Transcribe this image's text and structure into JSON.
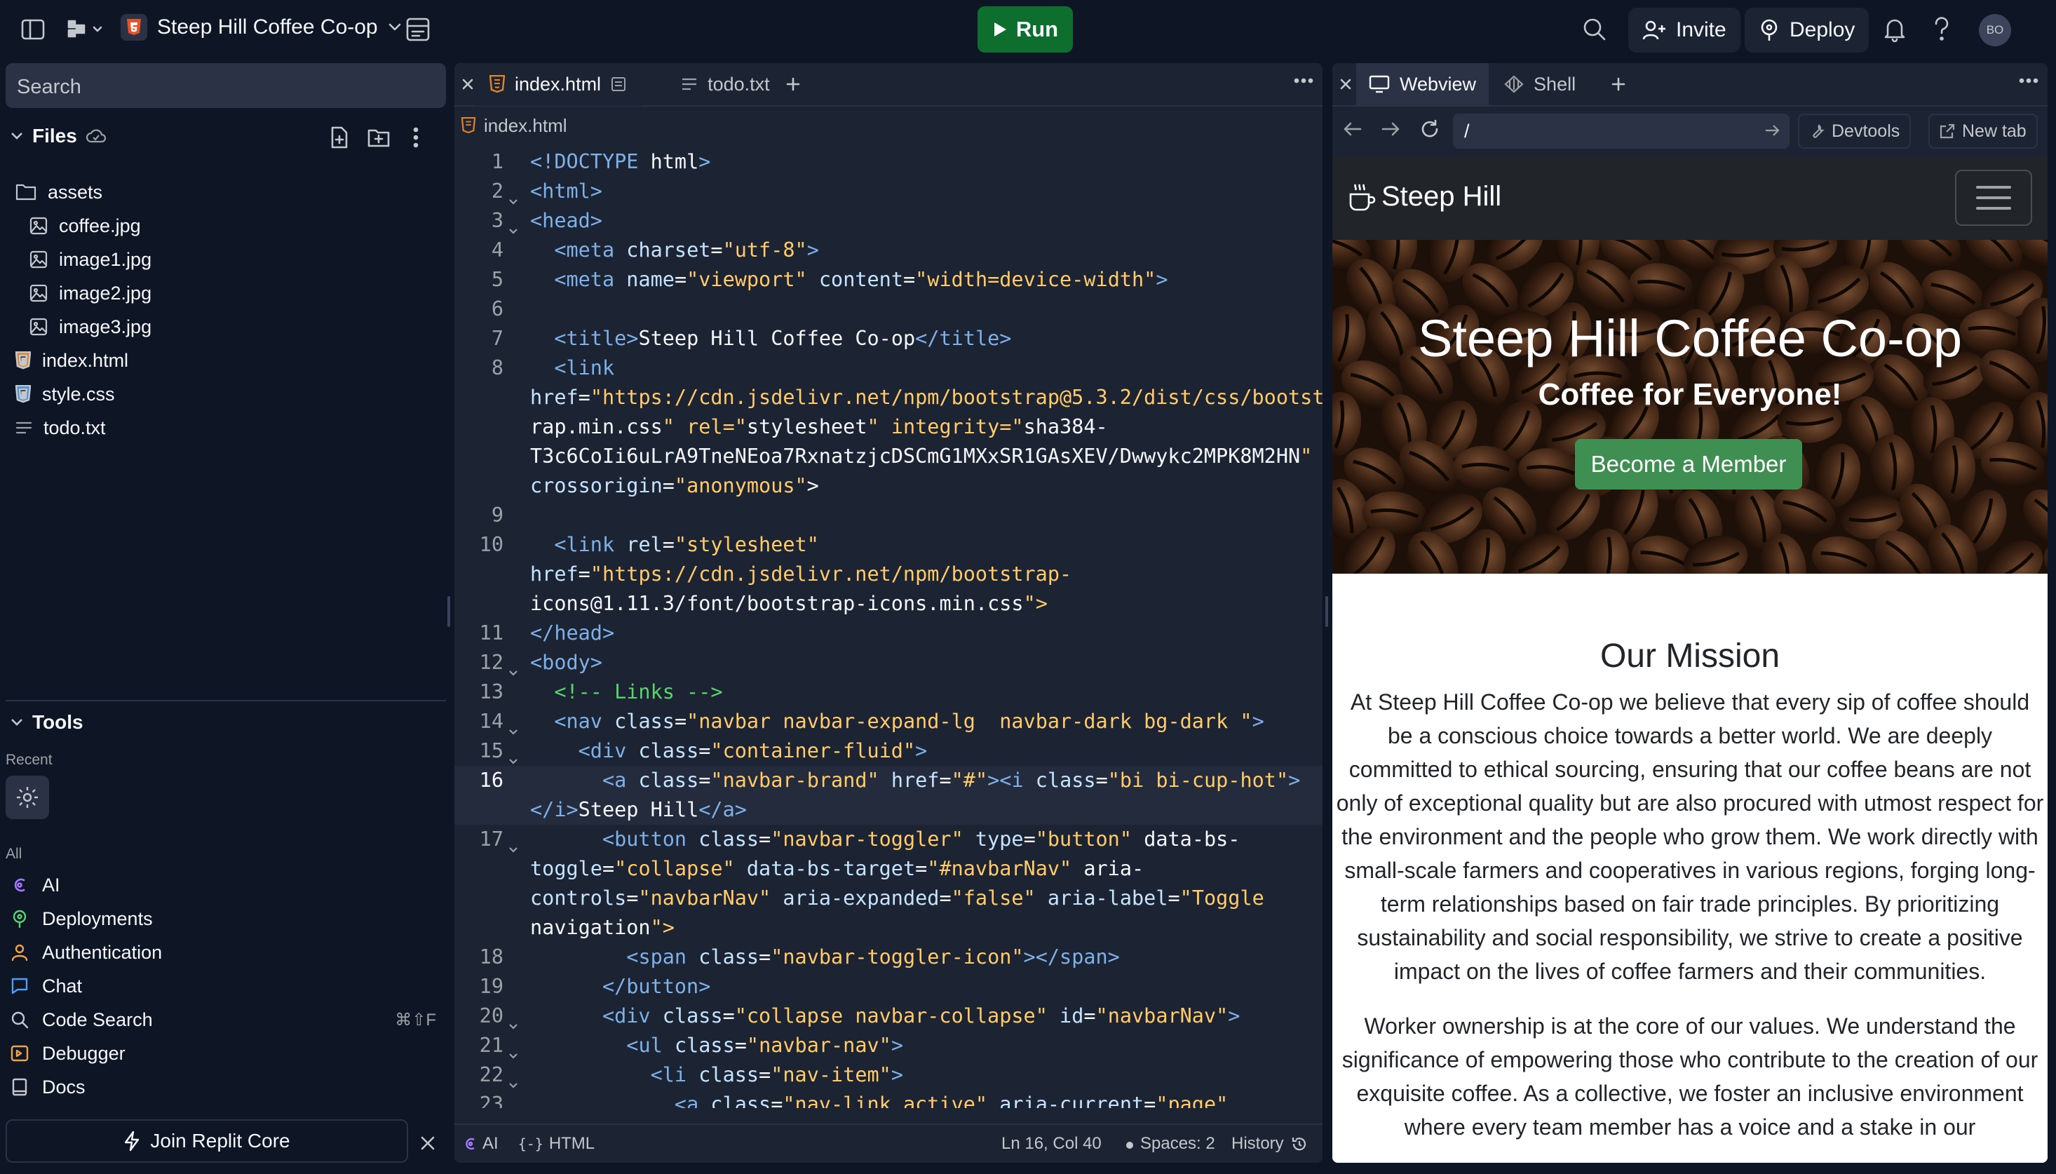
{
  "topbar": {
    "project_name": "Steep Hill Coffee Co-op",
    "run_label": "Run",
    "invite_label": "Invite",
    "deploy_label": "Deploy",
    "avatar_initials": "BO"
  },
  "sidebar": {
    "search_placeholder": "Search",
    "files_title": "Files",
    "files": [
      {
        "name": "assets",
        "type": "folder"
      },
      {
        "name": "coffee.jpg",
        "type": "image"
      },
      {
        "name": "image1.jpg",
        "type": "image"
      },
      {
        "name": "image2.jpg",
        "type": "image"
      },
      {
        "name": "image3.jpg",
        "type": "image"
      },
      {
        "name": "index.html",
        "type": "html"
      },
      {
        "name": "style.css",
        "type": "css"
      },
      {
        "name": "todo.txt",
        "type": "text"
      }
    ],
    "tools_title": "Tools",
    "recent_label": "Recent",
    "all_label": "All",
    "tools": [
      {
        "name": "AI",
        "icon": "ai-icon"
      },
      {
        "name": "Deployments",
        "icon": "deploy-icon"
      },
      {
        "name": "Authentication",
        "icon": "user-icon"
      },
      {
        "name": "Chat",
        "icon": "chat-icon"
      },
      {
        "name": "Code Search",
        "icon": "search-icon",
        "shortcut": "⌘⇧F"
      },
      {
        "name": "Debugger",
        "icon": "debugger-icon"
      },
      {
        "name": "Docs",
        "icon": "docs-icon"
      }
    ],
    "join_label": "Join Replit Core"
  },
  "editor": {
    "tabs": [
      {
        "label": "index.html",
        "active": true
      },
      {
        "label": "todo.txt",
        "active": false
      }
    ],
    "breadcrumb": "index.html",
    "current_line": "16",
    "lines": [
      {
        "n": "1",
        "fold": false,
        "rows": [
          "<!DOCTYPE html>"
        ]
      },
      {
        "n": "2",
        "fold": true,
        "rows": [
          "<html>"
        ]
      },
      {
        "n": "3",
        "fold": true,
        "rows": [
          "<head>"
        ]
      },
      {
        "n": "4",
        "fold": false,
        "rows": [
          "  <meta charset=\"utf-8\">"
        ]
      },
      {
        "n": "5",
        "fold": false,
        "rows": [
          "  <meta name=\"viewport\" content=\"width=device-width\">"
        ]
      },
      {
        "n": "6",
        "fold": false,
        "rows": [
          ""
        ]
      },
      {
        "n": "7",
        "fold": false,
        "rows": [
          "  <title>Steep Hill Coffee Co-op</title>"
        ]
      },
      {
        "n": "8",
        "fold": false,
        "rows": [
          "  <link",
          "href=\"https://cdn.jsdelivr.net/npm/bootstrap@5.3.2/dist/css/bootst",
          "rap.min.css\" rel=\"stylesheet\" integrity=\"sha384-",
          "T3c6CoIi6uLrA9TneNEoa7RxnatzjcDSCmG1MXxSR1GAsXEV/Dwwykc2MPK8M2HN\"",
          "crossorigin=\"anonymous\">"
        ]
      },
      {
        "n": "9",
        "fold": false,
        "rows": [
          ""
        ]
      },
      {
        "n": "10",
        "fold": false,
        "rows": [
          "  <link rel=\"stylesheet\"",
          "href=\"https://cdn.jsdelivr.net/npm/bootstrap-",
          "icons@1.11.3/font/bootstrap-icons.min.css\">"
        ]
      },
      {
        "n": "11",
        "fold": false,
        "rows": [
          "</head>"
        ]
      },
      {
        "n": "12",
        "fold": true,
        "rows": [
          "<body>"
        ]
      },
      {
        "n": "13",
        "fold": false,
        "rows": [
          "  <!-- Links -->"
        ]
      },
      {
        "n": "14",
        "fold": true,
        "rows": [
          "  <nav class=\"navbar navbar-expand-lg  navbar-dark bg-dark \">"
        ]
      },
      {
        "n": "15",
        "fold": true,
        "rows": [
          "    <div class=\"container-fluid\">"
        ]
      },
      {
        "n": "16",
        "fold": false,
        "rows": [
          "      <a class=\"navbar-brand\" href=\"#\"><i class=\"bi bi-cup-hot\">",
          "</i>Steep Hill</a>"
        ]
      },
      {
        "n": "17",
        "fold": true,
        "rows": [
          "      <button class=\"navbar-toggler\" type=\"button\" data-bs-",
          "toggle=\"collapse\" data-bs-target=\"#navbarNav\" aria-",
          "controls=\"navbarNav\" aria-expanded=\"false\" aria-label=\"Toggle",
          "navigation\">"
        ]
      },
      {
        "n": "18",
        "fold": false,
        "rows": [
          "        <span class=\"navbar-toggler-icon\"></span>"
        ]
      },
      {
        "n": "19",
        "fold": false,
        "rows": [
          "      </button>"
        ]
      },
      {
        "n": "20",
        "fold": true,
        "rows": [
          "      <div class=\"collapse navbar-collapse\" id=\"navbarNav\">"
        ]
      },
      {
        "n": "21",
        "fold": true,
        "rows": [
          "        <ul class=\"navbar-nav\">"
        ]
      },
      {
        "n": "22",
        "fold": true,
        "rows": [
          "          <li class=\"nav-item\">"
        ]
      },
      {
        "n": "23",
        "fold": false,
        "rows": [
          "            <a class=\"nav-link active\" aria-current=\"page\""
        ]
      }
    ],
    "status": {
      "ai": "AI",
      "lang": "HTML",
      "position": "Ln 16, Col 40",
      "spaces": "Spaces: 2",
      "history": "History"
    }
  },
  "preview": {
    "tabs": [
      {
        "label": "Webview",
        "active": true
      },
      {
        "label": "Shell",
        "active": false
      }
    ],
    "url": "/",
    "devtools_label": "Devtools",
    "newtab_label": "New tab",
    "site": {
      "brand": "Steep Hill",
      "hero_title": "Steep Hill Coffee Co-op",
      "hero_subtitle": "Coffee for Everyone!",
      "cta": "Become a Member",
      "mission_title": "Our Mission",
      "mission_p1": "At Steep Hill Coffee Co-op we believe that every sip of coffee should be a conscious choice towards a better world. We are deeply committed to ethical sourcing, ensuring that our coffee beans are not only of exceptional quality but are also procured with utmost respect for the environment and the people who grow them. We work directly with small-scale farmers and cooperatives in various regions, forging long-term relationships based on fair trade principles. By prioritizing sustainability and social responsibility, we strive to create a positive impact on the lives of coffee farmers and their communities.",
      "mission_p2": "Worker ownership is at the core of our values. We understand the significance of empowering those who contribute to the creation of our exquisite coffee. As a collective, we foster an inclusive environment where every team member has a voice and a stake in our"
    }
  },
  "colors": {
    "bg": "#0e1525",
    "panel": "#1c2333",
    "run": "#0d6e2e",
    "cta": "#3f8f52"
  }
}
